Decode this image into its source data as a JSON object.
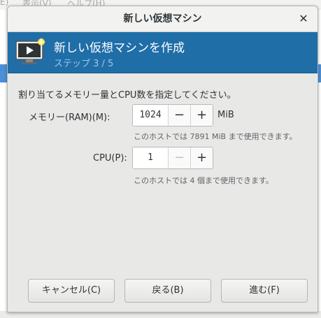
{
  "background": {
    "menubar_left": "E)",
    "menubar_view": "表示(V)",
    "menubar_help": "ヘルプ(H)"
  },
  "dialog": {
    "title": "新しい仮想マシン",
    "close_icon": "close-icon"
  },
  "banner": {
    "icon": "new-vm-icon",
    "heading": "新しい仮想マシンを作成",
    "step": "ステップ 3 / 5"
  },
  "content": {
    "instruction": "割り当てるメモリー量とCPU数を指定してください。",
    "memory": {
      "label": "メモリー(RAM)(M):",
      "value": "1024",
      "minus": "−",
      "plus": "+",
      "unit": "MiB",
      "hint": "このホストでは 7891 MiB まで使用できます。"
    },
    "cpu": {
      "label": "CPU(P):",
      "value": "1",
      "minus": "−",
      "plus": "+",
      "hint": "このホストでは 4 個まで使用できます。"
    }
  },
  "footer": {
    "cancel": "キャンセル(C)",
    "back": "戻る(B)",
    "forward": "進む(F)"
  },
  "colors": {
    "banner": "#1f6ea8",
    "dialog_bg": "#e8e8e7",
    "accent_strip": "#4a90d9"
  }
}
